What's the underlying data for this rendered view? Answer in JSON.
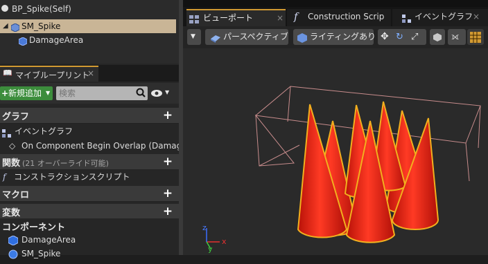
{
  "components": {
    "root": "BP_Spike(Self)",
    "items": [
      {
        "label": "SM_Spike",
        "icon": "static-mesh-icon"
      },
      {
        "label": "DamageArea",
        "icon": "box-collision-icon"
      }
    ]
  },
  "my_blueprint": {
    "tab_label": "マイブループリント",
    "add_new": "新規追加",
    "search_placeholder": "検索",
    "sections": {
      "graphs": "グラフ",
      "functions": "関数",
      "functions_note": "(21 オーバーライド可能)",
      "macros": "マクロ",
      "variables": "変数",
      "components": "コンポーネント"
    },
    "items": {
      "event_graph": "イベントグラフ",
      "overlap": "On Component Begin Overlap (Damag",
      "construction_script": "コンストラクションスクリプト",
      "damage_area": "DamageArea",
      "sm_spike": "SM_Spike"
    }
  },
  "editor_tabs": [
    {
      "label": "ビューポート",
      "active": true
    },
    {
      "label": "Construction Scrip",
      "active": false
    },
    {
      "label": "イベントグラフ",
      "active": false
    }
  ],
  "viewport_toolbar": {
    "perspective": "パースペクティブ",
    "lighting": "ライティングあり"
  },
  "axes": {
    "x": "x",
    "y": "y",
    "z": "z"
  },
  "colors": {
    "accent": "#d29a32",
    "add_button": "#3c8d3c",
    "selection": "#c9b596",
    "spike_red": "#e8231a",
    "spike_outline": "#f2b01e"
  }
}
